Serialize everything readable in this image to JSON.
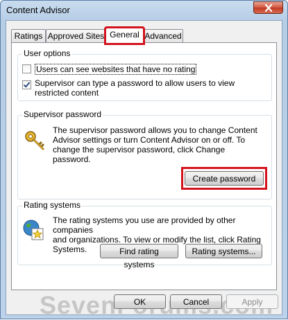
{
  "window": {
    "title": "Content Advisor",
    "close_icon": "close-icon"
  },
  "tabs": [
    {
      "label": "Ratings",
      "active": false
    },
    {
      "label": "Approved Sites",
      "active": false
    },
    {
      "label": "General",
      "active": true
    },
    {
      "label": "Advanced",
      "active": false
    }
  ],
  "user_options": {
    "title": "User options",
    "checkbox1": {
      "label": "Users can see websites that have no rating",
      "checked": false
    },
    "checkbox2": {
      "label_line1": "Supervisor can type a password to allow users to view",
      "label_line2": "restricted content",
      "checked": true
    }
  },
  "supervisor": {
    "title": "Supervisor password",
    "icon": "key-icon",
    "desc_line1": "The supervisor password allows you to change Content",
    "desc_line2": "Advisor settings or turn Content Advisor on or off. To",
    "desc_line3": "change the supervisor password, click Change",
    "desc_line4": "password.",
    "create_button": "Create password"
  },
  "rating_systems": {
    "title": "Rating systems",
    "icon": "globe-certificate-icon",
    "desc_line1": "The rating systems you use are provided by other companies",
    "desc_line2": "and organizations. To view or modify the list, click Rating",
    "desc_line3": "Systems.",
    "find_button": "Find rating systems",
    "systems_button": "Rating systems..."
  },
  "footer": {
    "ok": "OK",
    "cancel": "Cancel",
    "apply": "Apply"
  },
  "watermark": "SevenForums.com",
  "colors": {
    "highlight": "#d3121c",
    "title_bar": "#bcd2ea"
  }
}
